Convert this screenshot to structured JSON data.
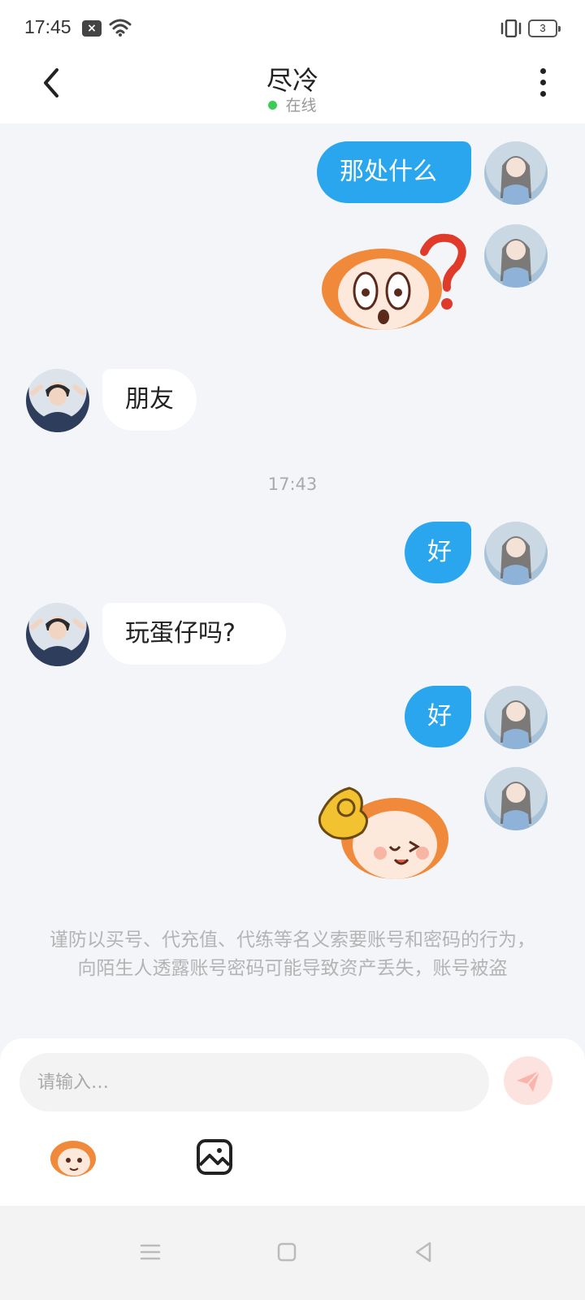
{
  "status_bar": {
    "time": "17:45",
    "battery": "3"
  },
  "header": {
    "title": "尽冷",
    "presence": "在线"
  },
  "messages": {
    "m1": "那处什么",
    "m2": "朋友",
    "timestamp": "17:43",
    "m3": "好",
    "m4": "玩蛋仔吗?",
    "m5": "好"
  },
  "notice": "谨防以买号、代充值、代练等名义索要账号和密码的行为，向陌生人透露账号密码可能导致资产丢失，账号被盗",
  "composer": {
    "placeholder": "请输入…"
  },
  "colors": {
    "accent": "#29a6ee",
    "presence": "#3ccc55",
    "send_bg": "#fde3e0"
  },
  "icons": [
    "back-icon",
    "more-icon",
    "emoji-sticker-icon",
    "image-icon",
    "send-icon",
    "wifi-icon",
    "vibrate-icon"
  ]
}
